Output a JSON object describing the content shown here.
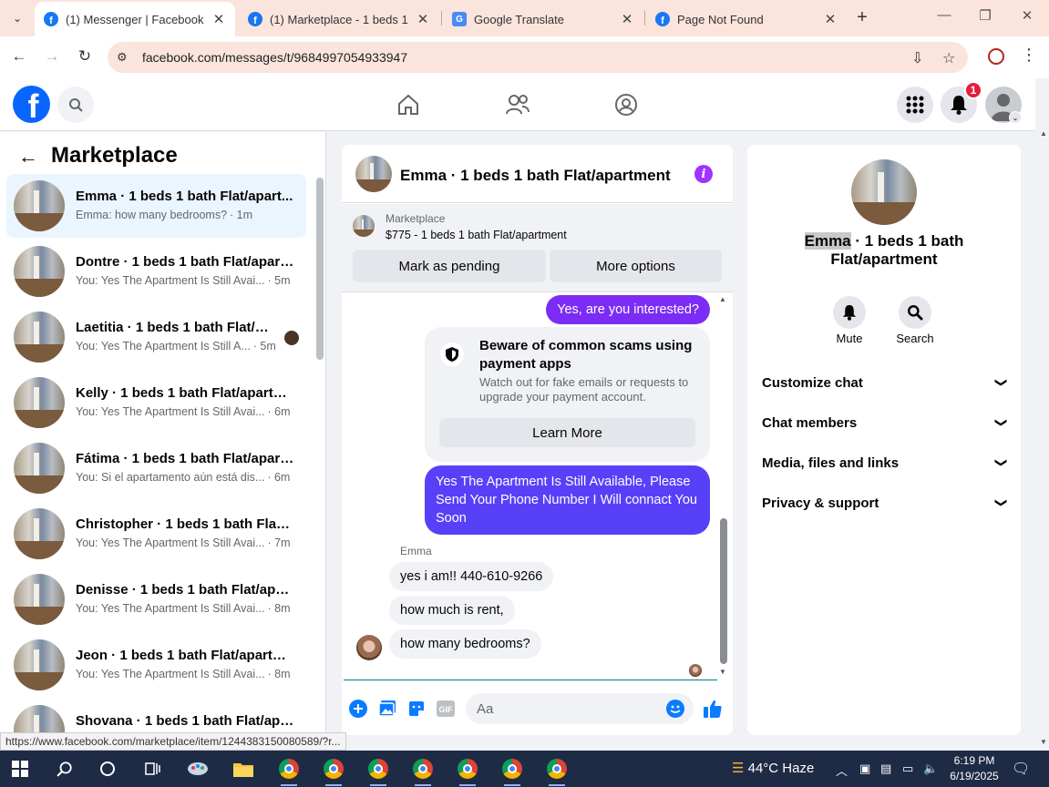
{
  "browser": {
    "tabs": [
      {
        "title": "(1) Messenger | Facebook",
        "favicon": "facebook-icon",
        "active": true
      },
      {
        "title": "(1) Marketplace - 1 beds 1 b",
        "favicon": "facebook-icon",
        "active": false
      },
      {
        "title": "Google Translate",
        "favicon": "google-translate-icon",
        "active": false
      },
      {
        "title": "Page Not Found",
        "favicon": "facebook-icon",
        "active": false
      }
    ],
    "url": "facebook.com/messages/t/9684997054933947",
    "status_url": "https://www.facebook.com/marketplace/item/1244383150080589/?r..."
  },
  "header": {
    "notification_count": "1"
  },
  "left_panel": {
    "title": "Marketplace",
    "conversations": [
      {
        "title": "Emma · 1 beds 1 bath Flat/apart...",
        "preview": "Emma: how many bedrooms?",
        "time": "· 1m",
        "active": true
      },
      {
        "title": "Dontre · 1 beds 1 bath Flat/apart...",
        "preview": "You: Yes The Apartment Is Still Avai...",
        "time": "· 5m"
      },
      {
        "title": "Laetitia · 1 beds 1 bath Flat/ap...",
        "preview": "You: Yes The Apartment Is Still A...",
        "time": "· 5m",
        "seen_avatar": true
      },
      {
        "title": "Kelly · 1 beds 1 bath Flat/apartm...",
        "preview": "You: Yes The Apartment Is Still Avai...",
        "time": "· 6m"
      },
      {
        "title": "Fátima · 1 beds 1 bath Flat/apart...",
        "preview": "You: Si el apartamento aún está dis...",
        "time": "· 6m"
      },
      {
        "title": "Christopher · 1 beds 1 bath Flat/...",
        "preview": "You: Yes The Apartment Is Still Avai...",
        "time": "· 7m"
      },
      {
        "title": "Denisse · 1 beds 1 bath Flat/apar...",
        "preview": "You: Yes The Apartment Is Still Avai...",
        "time": "· 8m"
      },
      {
        "title": "Jeon · 1 beds 1 bath Flat/apartm...",
        "preview": "You: Yes The Apartment Is Still Avai...",
        "time": "· 8m"
      },
      {
        "title": "Shovana · 1 beds 1 bath Flat/apa...",
        "preview": "",
        "time": ""
      }
    ]
  },
  "chat": {
    "title": "Emma · 1 beds 1 bath Flat/apartment",
    "marketplace_label": "Marketplace",
    "listing": "$775 - 1 beds 1 bath Flat/apartment",
    "mark_pending": "Mark as pending",
    "more_options": "More options",
    "messages": {
      "me_1": "Yes, are you interested?",
      "scam_title": "Beware of common scams using payment apps",
      "scam_text": "Watch out for fake emails or requests to upgrade your payment account.",
      "learn_more": "Learn More",
      "me_2": "Yes The Apartment Is Still Available, Please Send Your Phone Number I Will connact You Soon",
      "sender": "Emma",
      "them_1": "yes i am!! 440-610-9266",
      "them_2": "how much is rent,",
      "them_3": "how many bedrooms?"
    },
    "compose_placeholder": "Aa"
  },
  "right_panel": {
    "name_highlight": "Emma",
    "name_rest": " · 1 beds 1 bath Flat/apartment",
    "actions": [
      {
        "label": "Mute",
        "icon": "bell-icon"
      },
      {
        "label": "Search",
        "icon": "search-icon"
      }
    ],
    "sections": [
      "Customize chat",
      "Chat members",
      "Media, files and links",
      "Privacy & support"
    ]
  },
  "taskbar": {
    "weather": "44°C  Haze",
    "time": "6:19 PM",
    "date": "6/19/2025"
  },
  "colors": {
    "fb_blue": "#0866ff",
    "messenger_purple": "#7b2cf6",
    "messenger_blue": "#5840f9",
    "notification_red": "#e41e3f"
  }
}
